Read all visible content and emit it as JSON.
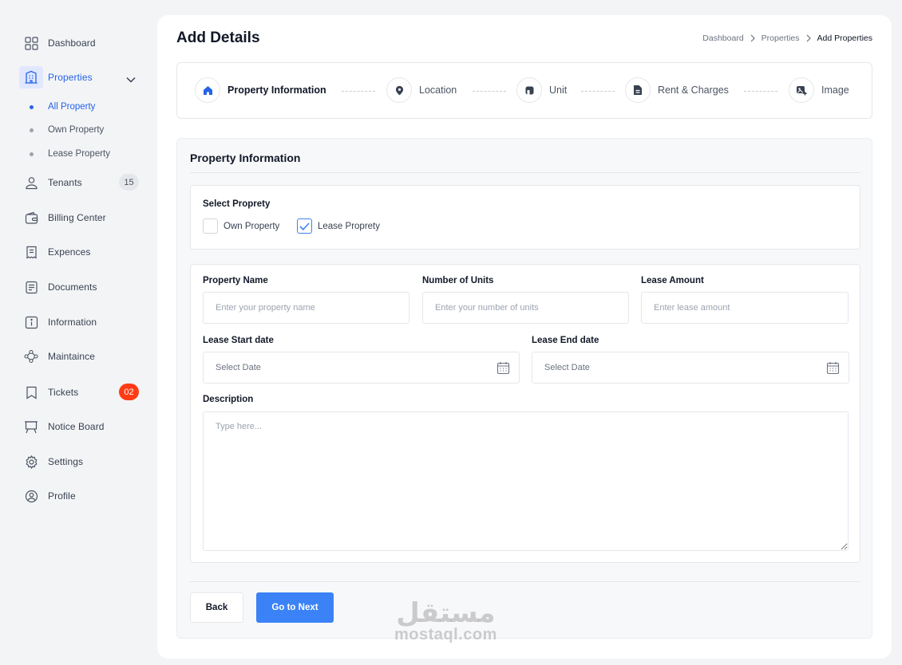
{
  "sidebar": {
    "items": [
      {
        "label": "Dashboard",
        "icon": "grid-icon"
      },
      {
        "label": "Properties",
        "icon": "building-icon"
      },
      {
        "label": "Tenants",
        "icon": "user-icon",
        "badge": "15"
      },
      {
        "label": "Billing Center",
        "icon": "wallet-icon"
      },
      {
        "label": "Expences",
        "icon": "receipt-icon"
      },
      {
        "label": "Documents",
        "icon": "document-icon"
      },
      {
        "label": "Information",
        "icon": "info-icon"
      },
      {
        "label": "Maintaince",
        "icon": "people-network-icon"
      },
      {
        "label": "Tickets",
        "icon": "ticket-icon",
        "badge": "02"
      },
      {
        "label": "Notice Board",
        "icon": "board-icon"
      },
      {
        "label": "Settings",
        "icon": "gear-icon"
      },
      {
        "label": "Profile",
        "icon": "profile-icon"
      }
    ],
    "subitems": [
      "All Property",
      "Own Property",
      "Lease Property"
    ],
    "active_color": "#2563eb"
  },
  "header": {
    "title": "Add Details",
    "breadcrumb": [
      "Dashboard",
      "Properties",
      "Add Properties"
    ]
  },
  "stepper": {
    "steps": [
      {
        "label": "Property  Information",
        "icon": "home-icon"
      },
      {
        "label": "Location",
        "icon": "location-pin-icon"
      },
      {
        "label": "Unit",
        "icon": "unit-icon"
      },
      {
        "label": "Rent & Charges",
        "icon": "file-icon"
      },
      {
        "label": "Image",
        "icon": "image-icon"
      }
    ],
    "active_step": "Property  Information"
  },
  "form": {
    "section_title": "Property  Information",
    "select_title": "Select Proprety",
    "options": [
      {
        "label": "Own Property",
        "checked": false
      },
      {
        "label": "Lease Proprety",
        "checked": true
      }
    ],
    "property_name": {
      "label": "Property Name",
      "placeholder": "Enter your property name"
    },
    "units": {
      "label": "Number of Units",
      "placeholder": "Enter your number of units"
    },
    "lease_amount": {
      "label": "Lease Amount",
      "placeholder": "Enter lease amount"
    },
    "lease_start": {
      "label": "Lease Start date",
      "value": "Select Date"
    },
    "lease_end": {
      "label": "Lease End date",
      "value": "Select Date"
    },
    "description": {
      "label": "Description",
      "placeholder": "Type here..."
    },
    "back_label": "Back",
    "next_label": "Go to Next"
  },
  "colors": {
    "primary": "#3b82f6",
    "badge_red": "#ff3b14"
  },
  "watermark": {
    "arabic": "مستقل",
    "latin": "mostaql.com"
  }
}
